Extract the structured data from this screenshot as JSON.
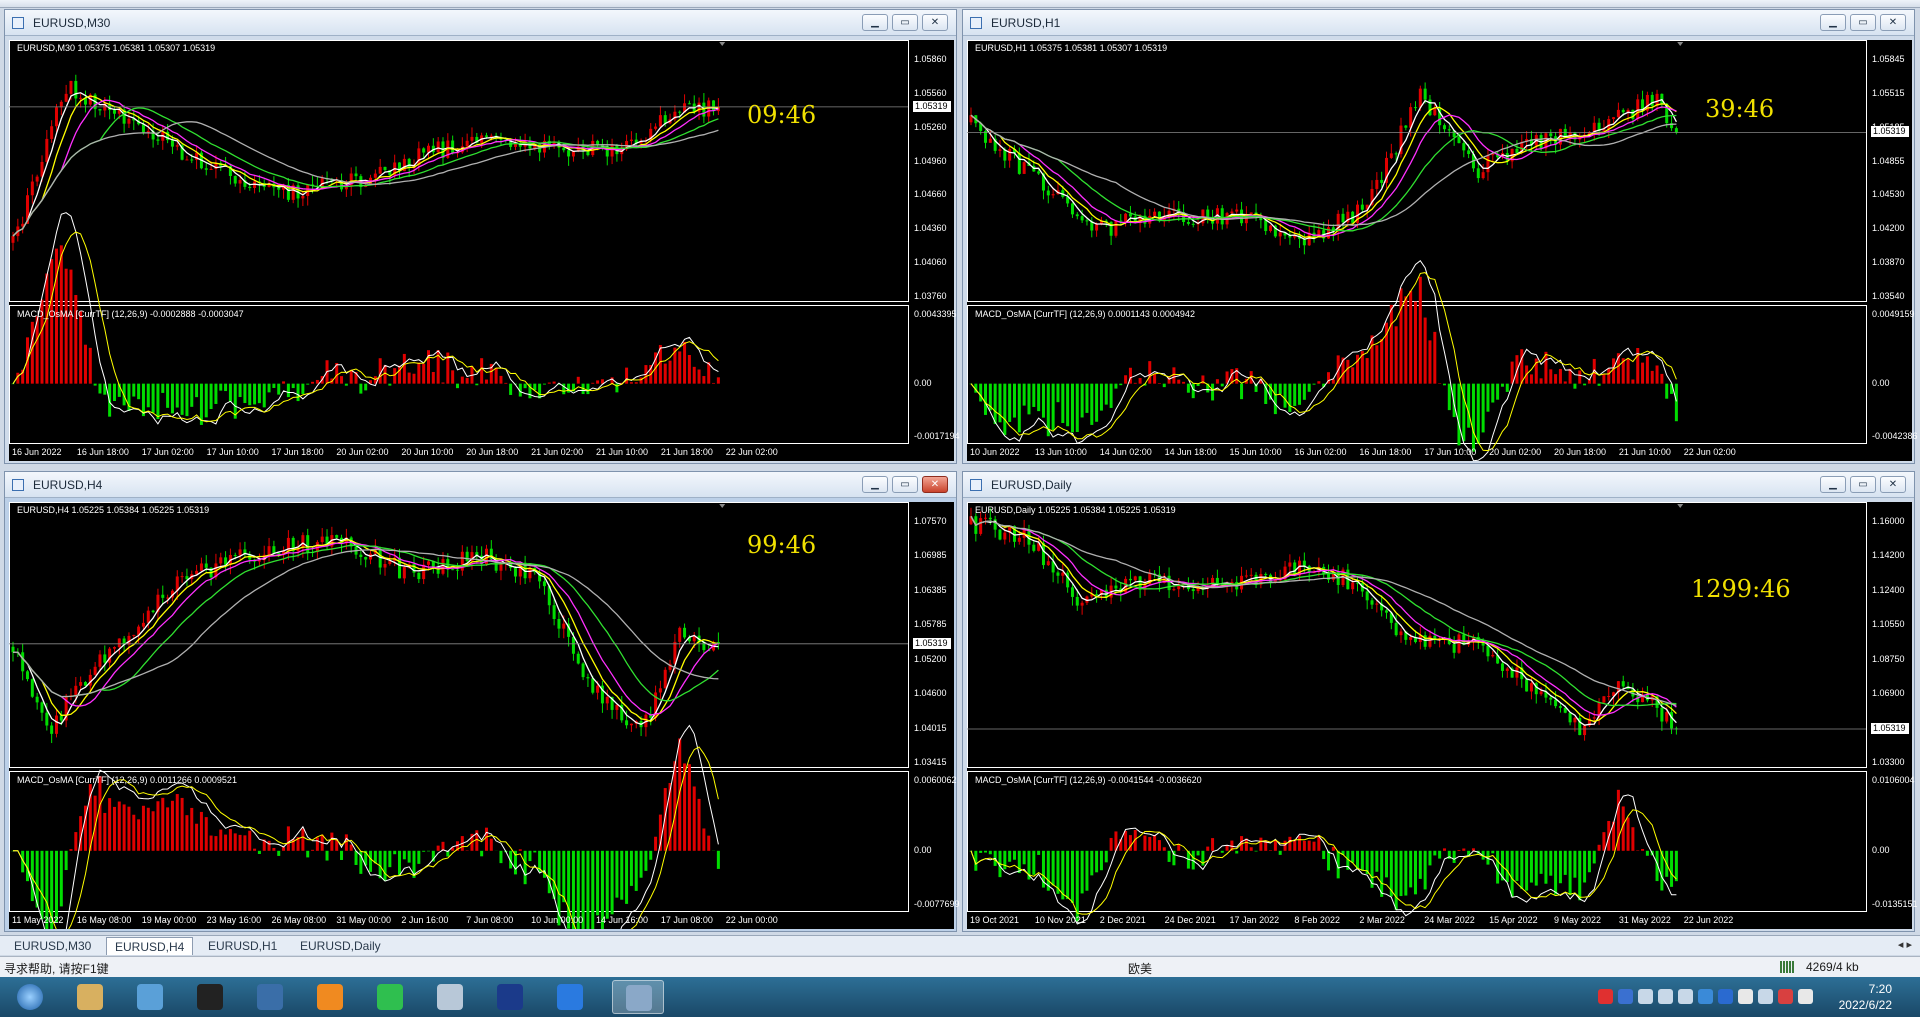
{
  "colors": {
    "bull": "#e00000",
    "bear": "#00dd00",
    "fast": "#ffffff",
    "mid": "#ffff00",
    "ema": "#ff30ff",
    "slow1": "#30e030",
    "slow2": "#b0b0b0"
  },
  "windows": [
    {
      "title": "EURUSD,M30",
      "ohlc": "EURUSD,M30  1.05375 1.05381 1.05307 1.05319",
      "macd": "MACD_OsMA [CurrTF] (12,26,9) -0.0002888 -0.0003047",
      "timer": "09:46",
      "prices": [
        "1.05860",
        "1.05560",
        "1.05260",
        "1.04960",
        "1.04660",
        "1.04360",
        "1.04060",
        "1.03760"
      ],
      "current": "1.05319",
      "macd_ticks": [
        "0.0043395",
        "0.00",
        "-0.0017194"
      ],
      "dates": [
        "16 Jun 2022",
        "16 Jun 18:00",
        "17 Jun 02:00",
        "17 Jun 10:00",
        "17 Jun 18:00",
        "20 Jun 02:00",
        "20 Jun 10:00",
        "20 Jun 18:00",
        "21 Jun 02:00",
        "21 Jun 10:00",
        "21 Jun 18:00",
        "22 Jun 02:00"
      ]
    },
    {
      "title": "EURUSD,H1",
      "ohlc": "EURUSD,H1  1.05375 1.05381 1.05307 1.05319",
      "macd": "MACD_OsMA [CurrTF] (12,26,9) 0.0001143 0.0004942",
      "timer": "39:46",
      "prices": [
        "1.05845",
        "1.05515",
        "1.05185",
        "1.04855",
        "1.04530",
        "1.04200",
        "1.03870",
        "1.03540"
      ],
      "current": "1.05319",
      "macd_ticks": [
        "0.0049159",
        "0.00",
        "-0.0042386"
      ],
      "dates": [
        "10 Jun 2022",
        "13 Jun 10:00",
        "14 Jun 02:00",
        "14 Jun 18:00",
        "15 Jun 10:00",
        "16 Jun 02:00",
        "16 Jun 18:00",
        "17 Jun 10:00",
        "20 Jun 02:00",
        "20 Jun 18:00",
        "21 Jun 10:00",
        "22 Jun 02:00"
      ]
    },
    {
      "title": "EURUSD,H4",
      "ohlc": "EURUSD,H4  1.05225 1.05384 1.05225 1.05319",
      "macd": "MACD_OsMA [CurrTF] (12,26,9) 0.0011266 0.0009521",
      "timer": "99:46",
      "prices": [
        "1.07570",
        "1.06985",
        "1.06385",
        "1.05785",
        "1.05200",
        "1.04600",
        "1.04015",
        "1.03415"
      ],
      "current": "1.05319",
      "macd_ticks": [
        "0.0060062",
        "0.00",
        "-0.0077699"
      ],
      "dates": [
        "11 May 2022",
        "16 May 08:00",
        "19 May 00:00",
        "23 May 16:00",
        "26 May 08:00",
        "31 May 00:00",
        "2 Jun 16:00",
        "7 Jun 08:00",
        "10 Jun 00:00",
        "14 Jun 16:00",
        "17 Jun 08:00",
        "22 Jun 00:00"
      ]
    },
    {
      "title": "EURUSD,Daily",
      "ohlc": "EURUSD,Daily  1.05225 1.05384 1.05225 1.05319",
      "macd": "MACD_OsMA [CurrTF] (12,26,9) -0.0041544 -0.0036620",
      "timer": "1299:46",
      "prices": [
        "1.16000",
        "1.14200",
        "1.12400",
        "1.10550",
        "1.08750",
        "1.06900",
        "1.05100",
        "1.03300"
      ],
      "current": "1.05319",
      "macd_ticks": [
        "0.0106004",
        "0.00",
        "-0.0135151"
      ],
      "dates": [
        "19 Oct 2021",
        "10 Nov 2021",
        "2 Dec 2021",
        "24 Dec 2021",
        "17 Jan 2022",
        "8 Feb 2022",
        "2 Mar 2022",
        "24 Mar 2022",
        "15 Apr 2022",
        "9 May 2022",
        "31 May 2022",
        "22 Jun 2022"
      ]
    }
  ],
  "tabs": [
    "EURUSD,M30",
    "EURUSD,H4",
    "EURUSD,H1",
    "EURUSD,Daily"
  ],
  "status": {
    "help": "寻求帮助, 请按F1键",
    "profile": "欧美",
    "traffic": "4269/4 kb"
  },
  "clock": {
    "time": "7:20",
    "date": "2022/6/22"
  },
  "taskbar_icons": [
    "start-orb-icon",
    "folder-icon",
    "network-icon",
    "terminal-icon",
    "monitor-icon",
    "browser-icon",
    "wechat-icon",
    "notebook-icon",
    "photoshop-icon",
    "feather-icon",
    "mt4-icon"
  ]
}
